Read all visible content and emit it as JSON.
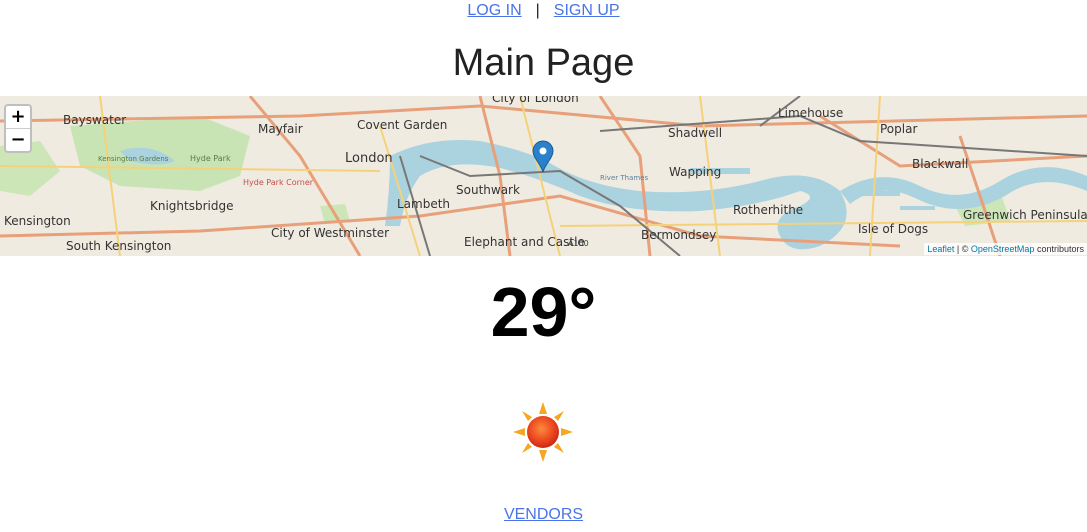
{
  "header": {
    "login_label": "LOG IN",
    "separator": "|",
    "signup_label": "SIGN UP"
  },
  "page": {
    "title": "Main Page"
  },
  "map": {
    "zoom_in_label": "+",
    "zoom_out_label": "−",
    "attribution": {
      "leaflet_label": "Leaflet",
      "separator": "| ©",
      "osm_label": "OpenStreetMap",
      "suffix": "contributors"
    },
    "place_labels": {
      "city_of_london": "City of London",
      "bayswater": "Bayswater",
      "mayfair": "Mayfair",
      "covent_garden": "Covent Garden",
      "london": "London",
      "shadwell": "Shadwell",
      "limehouse": "Limehouse",
      "poplar": "Poplar",
      "blackwall": "Blackwall",
      "kensington_gardens": "Kensington Gardens",
      "hyde_park": "Hyde Park",
      "hyde_park_corner": "Hyde Park Corner",
      "knightsbridge": "Knightsbridge",
      "kensington": "Kensington",
      "south_kensington": "South Kensington",
      "city_of_westminster": "City of Westminster",
      "lambeth": "Lambeth",
      "southwark": "Southwark",
      "elephant_and_castle": "Elephant and Castle",
      "a100": "A100",
      "bermondsey": "Bermondsey",
      "wapping": "Wapping",
      "rotherhithe": "Rotherhithe",
      "isle_of_dogs": "Isle of Dogs",
      "greenwich_peninsula": "Greenwich Peninsula",
      "river_thames": "River Thames"
    }
  },
  "weather": {
    "temperature": "29°",
    "condition_icon": "sun-icon"
  },
  "footer": {
    "vendors_label": "VENDORS"
  }
}
